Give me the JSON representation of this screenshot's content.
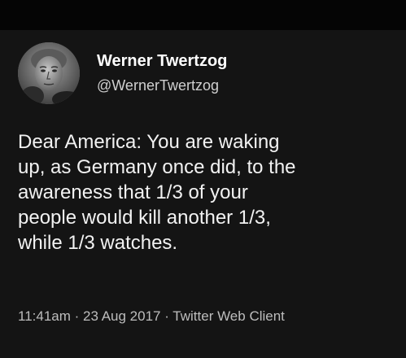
{
  "profile": {
    "display_name": "Werner Twertzog",
    "handle": "@WernerTwertzog"
  },
  "tweet": {
    "lines": [
      "Dear America: You are waking",
      "up, as Germany once did, to the",
      "awareness that 1/3 of your",
      "people would kill another 1/3,",
      "while 1/3 watches."
    ]
  },
  "meta": {
    "text": "11:41am · 23 Aug 2017 · Twitter Web Client"
  },
  "colors": {
    "background": "#141414",
    "top_band": "#050505",
    "name_text": "#ffffff",
    "body_text": "#f2f2f2",
    "meta_text": "#bdbdbd"
  },
  "icons": {
    "avatar": "profile-photo"
  }
}
